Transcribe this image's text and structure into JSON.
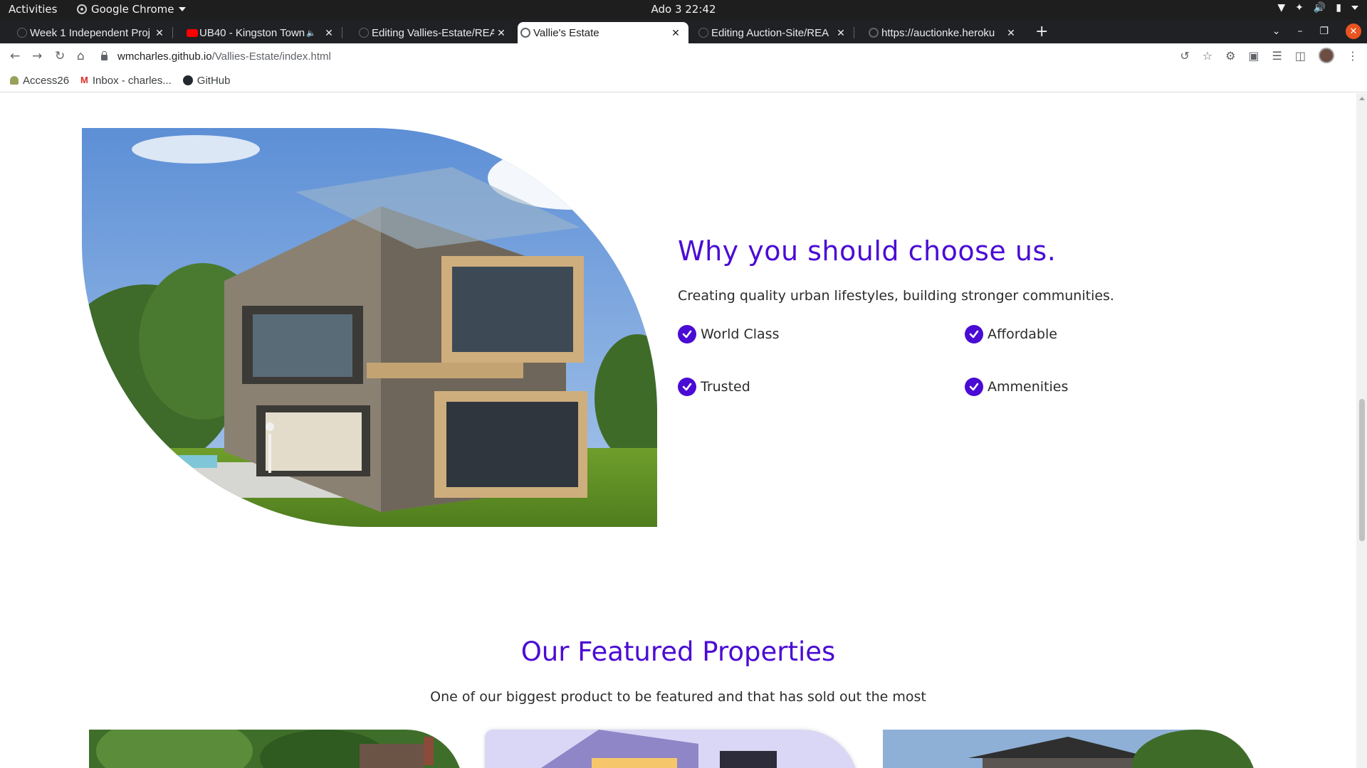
{
  "system": {
    "activities": "Activities",
    "app_name": "Google Chrome",
    "clock": "Ado 3  22:42"
  },
  "tabs": [
    {
      "title": "Week 1 Independent Proj",
      "favicon": "github-icon"
    },
    {
      "title": "UB40 - Kingston Town",
      "favicon": "youtube-icon"
    },
    {
      "title": "Editing Vallies-Estate/REA",
      "favicon": "github-icon"
    },
    {
      "title": "Vallie's Estate",
      "favicon": "globe-icon"
    },
    {
      "title": "Editing Auction-Site/REA",
      "favicon": "github-icon"
    },
    {
      "title": "https://auctionke.heroku",
      "favicon": "globe-icon"
    }
  ],
  "address_bar": {
    "host": "wmcharles.github.io",
    "path": "/Vallies-Estate/index.html"
  },
  "bookmarks": [
    {
      "label": "Access26"
    },
    {
      "label": "Inbox - charles..."
    },
    {
      "label": "GitHub"
    }
  ],
  "page": {
    "why_title": "Why you should choose us.",
    "why_subtitle": "Creating quality urban lifestyles, building stronger communities.",
    "features": [
      "World Class",
      "Affordable",
      "Trusted",
      "Ammenities"
    ],
    "featured_title": "Our Featured Properties",
    "featured_subtitle": "One of our biggest product to be featured and that has sold out the most"
  },
  "colors": {
    "accent": "#4a0bd4",
    "window_close": "#e95420"
  }
}
